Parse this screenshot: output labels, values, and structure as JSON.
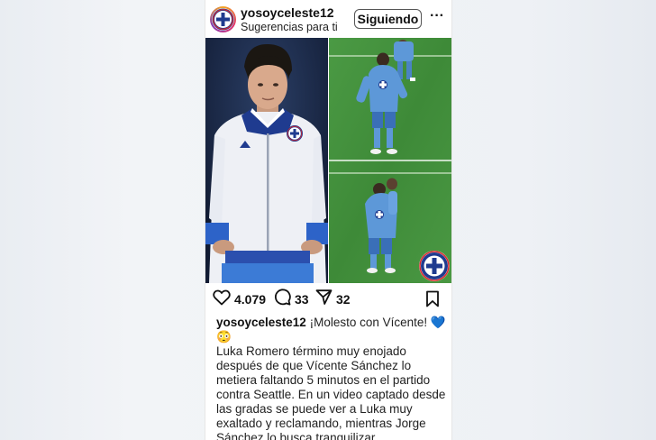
{
  "post": {
    "username": "yosoyceleste12",
    "subtitle": "Sugerencias para ti",
    "follow_label": "Siguiendo",
    "more_label": "···"
  },
  "actions": {
    "likes": "4.079",
    "comments": "33",
    "shares": "32"
  },
  "caption": {
    "headline": "¡Molesto con Vícente! 💙",
    "emoji": "😳",
    "text": "Luka Romero término muy enojado después de que Vícente Sánchez lo metiera faltando 5 minutos en el partido contra Seattle. En un video captado desde las gradas se puede ver a Luka muy exaltado y reclamando, mientras Jorge Sánchez lo busca tranquilizar."
  },
  "colors": {
    "club_blue": "#1f3b8f",
    "club_red": "#d9262c",
    "jersey_blue": "#4f8fd4",
    "pitch_green": "#3f8a3a"
  },
  "icons": [
    "heart-icon",
    "comment-icon",
    "share-icon",
    "bookmark-icon",
    "more-icon"
  ]
}
